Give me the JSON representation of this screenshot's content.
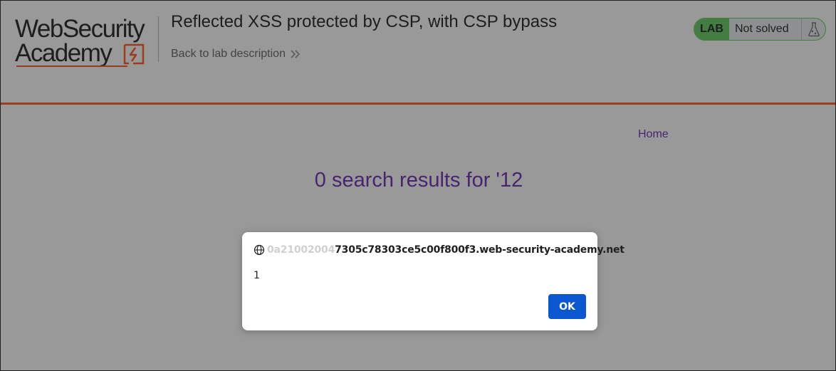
{
  "header": {
    "logo": {
      "line1": "WebSecurity",
      "line2": "Academy"
    },
    "lab_title": "Reflected XSS protected by CSP, with CSP bypass",
    "back_link": "Back to lab description",
    "lab_status": {
      "badge": "LAB",
      "status": "Not solved"
    }
  },
  "nav": {
    "home": "Home"
  },
  "main": {
    "search_heading": "0 search results for '12"
  },
  "dialog": {
    "origin_faded": "0a21002004",
    "origin_visible": "7305c78303ce5c00f800f3.web-security-academy.net",
    "message": "1",
    "ok_label": "OK"
  },
  "colors": {
    "accent_orange": "#ff6633",
    "lab_green": "#70d16d",
    "link_purple": "#7a3cb8",
    "dialog_button_blue": "#0b57d0"
  },
  "icons": {
    "logo_mark": "lightning-bolt-icon",
    "back_chevrons": "double-chevron-right-icon",
    "lab_flask": "flask-icon",
    "dialog_globe": "globe-icon"
  }
}
